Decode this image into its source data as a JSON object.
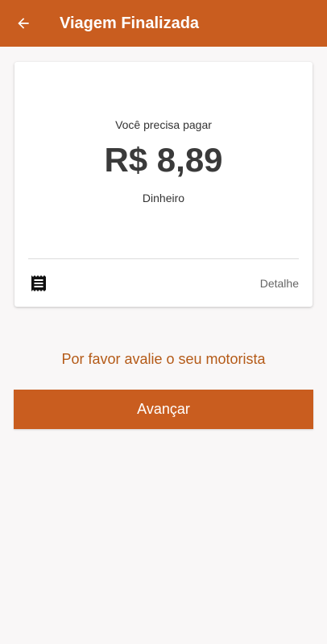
{
  "header": {
    "title": "Viagem Finalizada",
    "back_icon": "arrow-left-icon",
    "background": "#c95d1f"
  },
  "payment_card": {
    "prompt": "Você precisa pagar",
    "amount": "R$ 8,89",
    "method": "Dinheiro",
    "receipt_icon": "receipt-icon",
    "detail_label": "Detalhe"
  },
  "rating": {
    "prompt": "Por favor avalie o seu motorista",
    "color": "#b45a17"
  },
  "actions": {
    "next_label": "Avançar",
    "color": "#c95d1f"
  }
}
